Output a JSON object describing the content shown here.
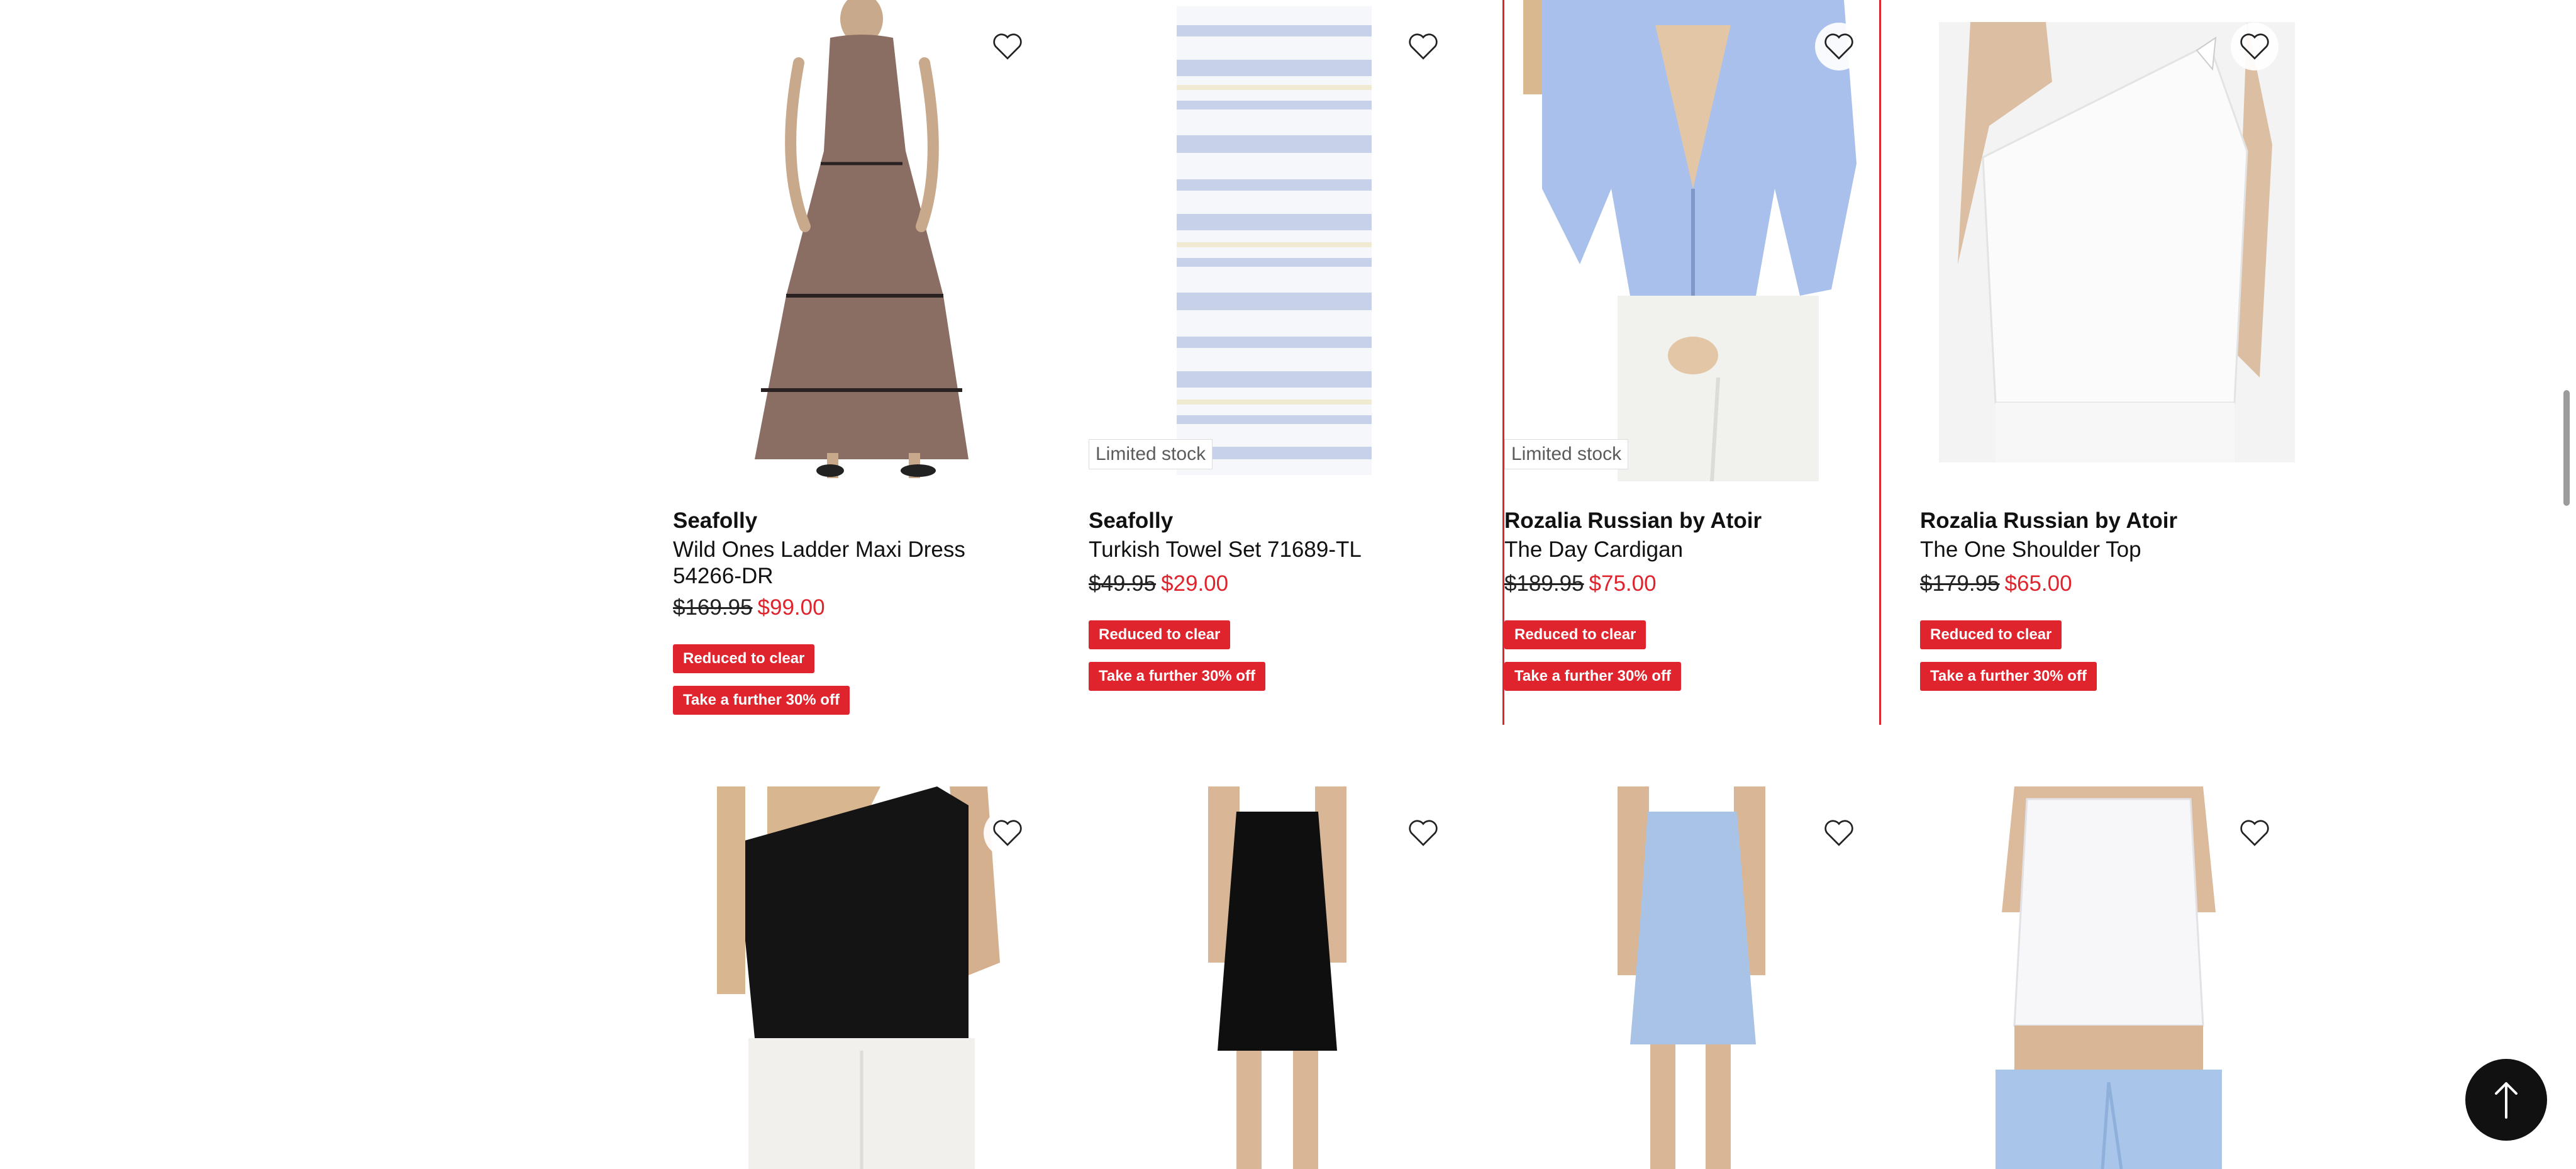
{
  "products": [
    {
      "brand": "Seafolly",
      "name": "Wild Ones Ladder Maxi Dress 54266-DR",
      "was": "$169.95",
      "now": "$99.00",
      "limited": "",
      "badge1": "Reduced to clear",
      "badge2": "Take a further 30% off",
      "wishlist_icon": "heart-outline-icon"
    },
    {
      "brand": "Seafolly",
      "name": "Turkish Towel Set 71689-TL",
      "was": "$49.95",
      "now": "$29.00",
      "limited": "Limited stock",
      "badge1": "Reduced to clear",
      "badge2": "Take a further 30% off",
      "wishlist_icon": "heart-outline-icon"
    },
    {
      "brand": "Rozalia Russian by Atoir",
      "name": "The Day Cardigan",
      "was": "$189.95",
      "now": "$75.00",
      "limited": "Limited stock",
      "badge1": "Reduced to clear",
      "badge2": "Take a further 30% off",
      "wishlist_icon": "heart-outline-icon"
    },
    {
      "brand": "Rozalia Russian by Atoir",
      "name": "The One Shoulder Top",
      "was": "$179.95",
      "now": "$65.00",
      "limited": "",
      "badge1": "Reduced to clear",
      "badge2": "Take a further 30% off",
      "wishlist_icon": "heart-outline-icon"
    }
  ],
  "colors": {
    "sale": "#e0242d",
    "text": "#111111",
    "background": "#ffffff"
  },
  "back_to_top_icon": "arrow-up-icon"
}
